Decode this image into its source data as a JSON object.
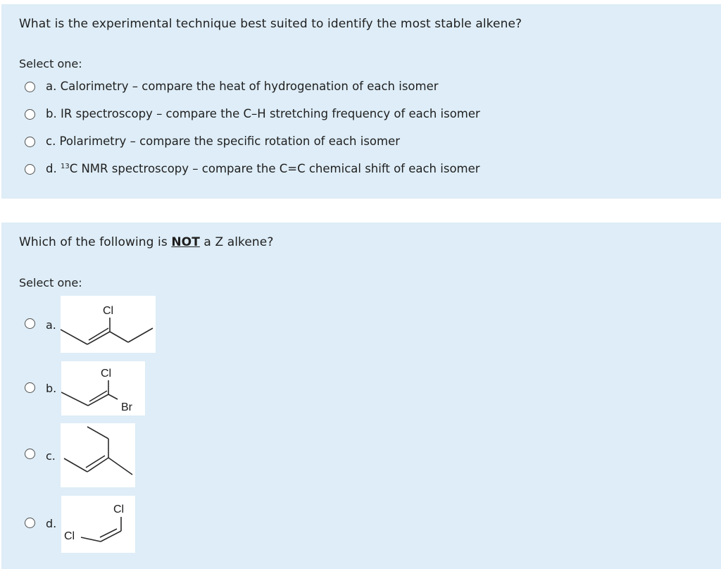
{
  "q1": {
    "question": "What is the experimental technique best suited to identify the most stable alkene?",
    "select_label": "Select one:",
    "options": [
      {
        "label": "a. Calorimetry – compare the heat of hydrogenation of each isomer"
      },
      {
        "label": "b. IR spectroscopy – compare the C–H stretching frequency of each isomer"
      },
      {
        "label": "c. Polarimetry – compare the specific rotation of each isomer"
      },
      {
        "prefix": "d. ",
        "sup": "13",
        "label": "C NMR spectroscopy – compare the C=C chemical shift of each isomer"
      }
    ]
  },
  "q2": {
    "question_pre": "Which of the following is ",
    "question_emph": "NOT",
    "question_post": " a Z alkene?",
    "select_label": "Select one:",
    "options": [
      {
        "letter": "a.",
        "atoms": [
          "Cl"
        ]
      },
      {
        "letter": "b.",
        "atoms": [
          "Cl",
          "Br"
        ]
      },
      {
        "letter": "c.",
        "atoms": []
      },
      {
        "letter": "d.",
        "atoms": [
          "Cl",
          "Cl"
        ]
      }
    ]
  }
}
